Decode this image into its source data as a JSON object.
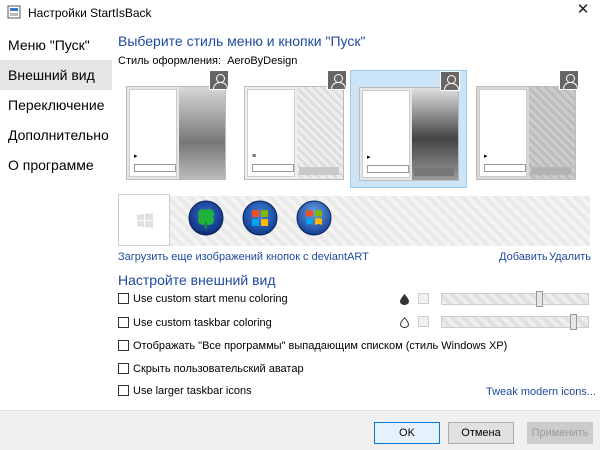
{
  "window": {
    "title": "Настройки StartIsBack",
    "close_glyph": "✕"
  },
  "sidebar": {
    "items": [
      {
        "label": "Меню \"Пуск\""
      },
      {
        "label": "Внешний вид"
      },
      {
        "label": "Переключение"
      },
      {
        "label": "Дополнительно"
      },
      {
        "label": "О программе"
      }
    ],
    "active_index": 1
  },
  "style_section": {
    "heading": "Выберите стиль меню и кнопки \"Пуск\"",
    "style_label": "Стиль оформления:",
    "style_value": "AeroByDesign",
    "selected_thumbnail": 3
  },
  "button_links": {
    "download": "Загрузить еще изображений кнопок с deviantART",
    "add": "Добавить",
    "remove": "Удалить"
  },
  "appearance_section": {
    "heading": "Настройте внешний вид",
    "options": [
      {
        "label": "Use custom start menu coloring",
        "checked": false
      },
      {
        "label": "Use custom taskbar coloring",
        "checked": false
      },
      {
        "label": "Отображать \"Все программы\" выпадающим списком (стиль Windows XP)",
        "checked": false
      },
      {
        "label": "Скрыть пользовательский аватар",
        "checked": false
      },
      {
        "label": "Use larger taskbar icons",
        "checked": false
      }
    ],
    "tweak_link": "Tweak modern icons..."
  },
  "footer": {
    "ok": "OK",
    "cancel": "Отмена",
    "apply": "Применить"
  },
  "colors": {
    "accent": "#1e4a9e",
    "selection": "#cce4f7",
    "nav_active": "#e5e5e5"
  }
}
